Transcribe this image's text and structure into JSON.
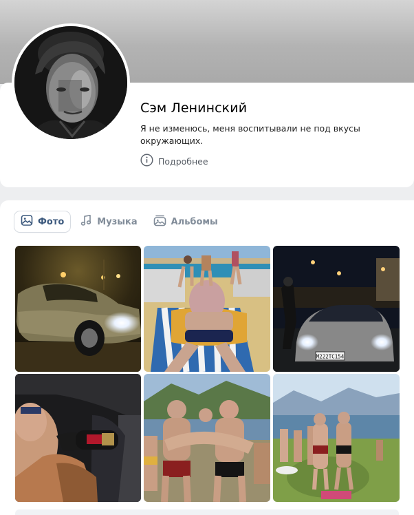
{
  "profile": {
    "name": "Сэм Ленинский",
    "status": "Я не изменюсь, меня воспитывали не под вкусы окружающих.",
    "details_label": "Подробнее",
    "details_icon": "info-circle-icon"
  },
  "media": {
    "tabs": [
      {
        "label": "Фото",
        "icon": "image-icon",
        "active": true
      },
      {
        "label": "Музыка",
        "icon": "music-note-icon",
        "active": false
      },
      {
        "label": "Альбомы",
        "icon": "albums-icon",
        "active": false
      }
    ],
    "photos": [
      {
        "name": "photo-night-car"
      },
      {
        "name": "photo-beach-lounger"
      },
      {
        "name": "photo-night-street-car"
      },
      {
        "name": "photo-car-interior-drink"
      },
      {
        "name": "photo-lake-group"
      },
      {
        "name": "photo-lake-shore-group"
      }
    ],
    "license_plate": "М222ТС154"
  },
  "colors": {
    "page_background": "#edeef0",
    "card_background": "#ffffff",
    "active_tab_text": "#3d5a7e",
    "inactive_tab_text": "#818c99",
    "secondary_text": "#555b63"
  }
}
